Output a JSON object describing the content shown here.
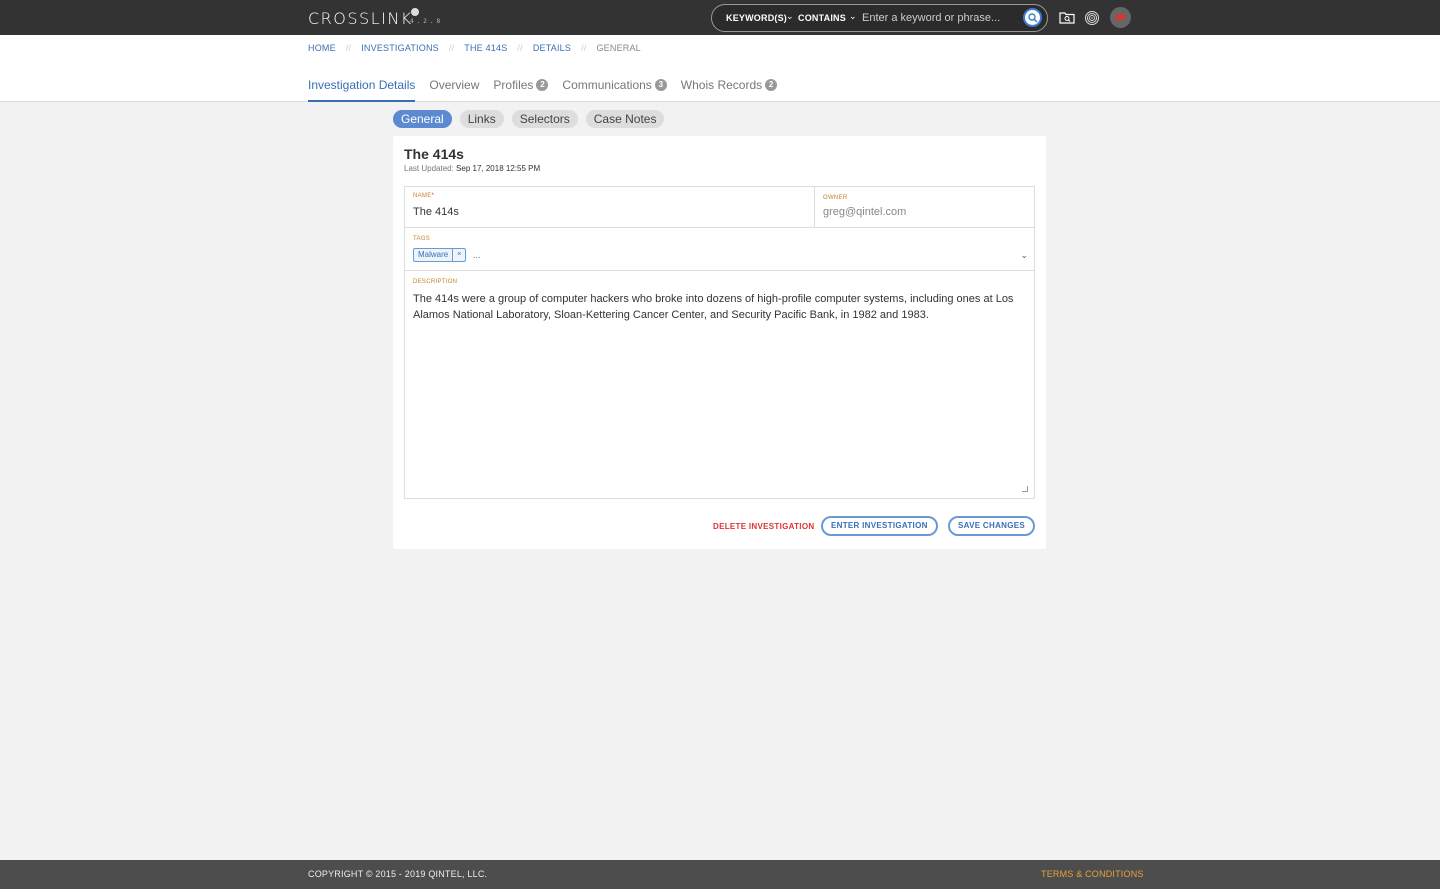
{
  "app": {
    "logo": "CROSSLINK",
    "version": "4.2.8"
  },
  "search": {
    "type_label": "KEYWORD(S)",
    "operator_label": "CONTAINS",
    "placeholder": "Enter a keyword or phrase...",
    "value": ""
  },
  "icons": {
    "search": "search-icon",
    "investigation": "folder-search-icon",
    "fingerprint": "fingerprint-icon",
    "avatar": "user-avatar-icon"
  },
  "breadcrumb": [
    {
      "label": "HOME"
    },
    {
      "label": "INVESTIGATIONS"
    },
    {
      "label": "THE 414S"
    },
    {
      "label": "DETAILS"
    },
    {
      "label": "GENERAL"
    }
  ],
  "tabs": [
    {
      "label": "Investigation Details",
      "badge": ""
    },
    {
      "label": "Overview",
      "badge": ""
    },
    {
      "label": "Profiles",
      "badge": "2"
    },
    {
      "label": "Communications",
      "badge": "3"
    },
    {
      "label": "Whois Records",
      "badge": "2"
    }
  ],
  "subtabs": [
    {
      "label": "General"
    },
    {
      "label": "Links"
    },
    {
      "label": "Selectors"
    },
    {
      "label": "Case Notes"
    }
  ],
  "card": {
    "title": "The 414s",
    "updated_label": "Last Updated:",
    "updated_value": "Sep 17, 2018 12:55 PM"
  },
  "form": {
    "name_label": "NAME",
    "name_required": "*",
    "name_value": "The 414s",
    "owner_label": "OWNER",
    "owner_value": "greg@qintel.com",
    "tags_label": "TAGS",
    "tags": [
      {
        "label": "Malware",
        "remove": "×"
      }
    ],
    "tags_more": "...",
    "description_label": "DESCRIPTION",
    "description_value": "The 414s were a group of computer hackers who broke into dozens of high-profile computer systems, including ones at Los Alamos National Laboratory, Sloan-Kettering Cancer Center, and Security Pacific Bank, in 1982 and 1983."
  },
  "actions": {
    "delete": "DELETE INVESTIGATION",
    "enter": "ENTER INVESTIGATION",
    "save": "SAVE CHANGES"
  },
  "footer": {
    "copyright": "COPYRIGHT © 2015 - 2019 QINTEL, LLC.",
    "terms": "TERMS & CONDITIONS"
  },
  "colors": {
    "accent": "#3a6fb5",
    "danger": "#dd3333",
    "label": "#c6802e",
    "terms": "#e8a33a"
  }
}
